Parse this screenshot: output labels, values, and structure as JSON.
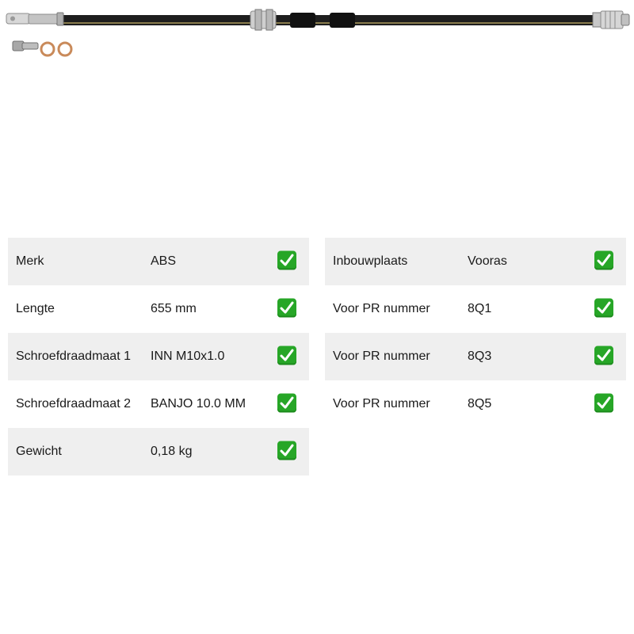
{
  "product_image": {
    "icon": "brake-hose-image"
  },
  "specs_left": [
    {
      "label": "Merk",
      "value": "ABS"
    },
    {
      "label": "Lengte",
      "value": "655 mm"
    },
    {
      "label": "Schroefdraadmaat 1",
      "value": "INN M10x1.0"
    },
    {
      "label": "Schroefdraadmaat 2",
      "value": "BANJO 10.0 MM"
    },
    {
      "label": "Gewicht",
      "value": "0,18 kg"
    }
  ],
  "specs_right": [
    {
      "label": "Inbouwplaats",
      "value": "Vooras"
    },
    {
      "label": "Voor PR nummer",
      "value": "8Q1"
    },
    {
      "label": "Voor PR nummer",
      "value": "8Q3"
    },
    {
      "label": "Voor PR nummer",
      "value": "8Q5"
    }
  ],
  "colors": {
    "row_shade": "#efefef",
    "check_green": "#27a627"
  }
}
